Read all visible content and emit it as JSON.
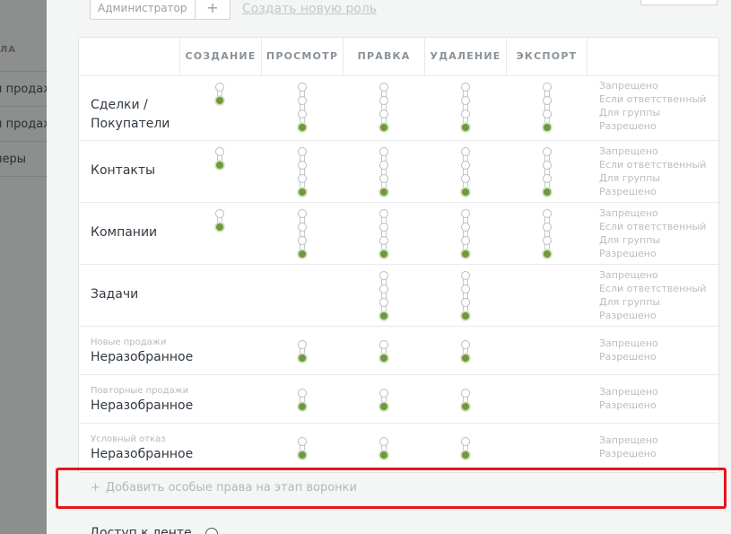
{
  "sidebar": {
    "header": "ЛА",
    "items": [
      {
        "label": "и продаж"
      },
      {
        "label": "и продаж"
      },
      {
        "label": "неры"
      }
    ]
  },
  "roles": {
    "selected": "Администратор",
    "add_symbol": "+",
    "create_link": "Создать новую роль"
  },
  "columns": [
    "СОЗДАНИЕ",
    "ПРОСМОТР",
    "ПРАВКА",
    "УДАЛЕНИЕ",
    "ЭКСПОРТ"
  ],
  "legend_full": [
    "Запрещено",
    "Если ответственный",
    "Для группы",
    "Разрешено"
  ],
  "legend_short": [
    "Запрещено",
    "Разрешено"
  ],
  "rows": [
    {
      "label_line1": "Сделки /",
      "label_line2": "Покупатели",
      "sublabel": ""
    },
    {
      "label_line1": "Контакты",
      "label_line2": "",
      "sublabel": ""
    },
    {
      "label_line1": "Компании",
      "label_line2": "",
      "sublabel": ""
    },
    {
      "label_line1": "Задачи",
      "label_line2": "",
      "sublabel": ""
    },
    {
      "label_line1": "Неразобранное",
      "label_line2": "",
      "sublabel": "Новые продажи"
    },
    {
      "label_line1": "Неразобранное",
      "label_line2": "",
      "sublabel": "Повторные продажи"
    },
    {
      "label_line1": "Неразобранное",
      "label_line2": "",
      "sublabel": "Условный отказ"
    }
  ],
  "permissions": [
    {
      "levels": [
        2,
        4,
        4,
        4,
        4
      ],
      "selected": [
        2,
        4,
        4,
        4,
        4
      ]
    },
    {
      "levels": [
        2,
        4,
        4,
        4,
        4
      ],
      "selected": [
        2,
        4,
        4,
        4,
        4
      ]
    },
    {
      "levels": [
        2,
        4,
        4,
        4,
        4
      ],
      "selected": [
        2,
        4,
        4,
        4,
        4
      ]
    },
    {
      "levels": [
        0,
        0,
        4,
        4,
        0
      ],
      "selected": [
        0,
        0,
        4,
        4,
        0
      ]
    },
    {
      "levels": [
        0,
        2,
        2,
        2,
        0
      ],
      "selected": [
        0,
        2,
        2,
        2,
        0
      ]
    },
    {
      "levels": [
        0,
        2,
        2,
        2,
        0
      ],
      "selected": [
        0,
        2,
        2,
        2,
        0
      ]
    },
    {
      "levels": [
        0,
        2,
        2,
        2,
        0
      ],
      "selected": [
        0,
        2,
        2,
        2,
        0
      ]
    }
  ],
  "add_special": {
    "plus": "+",
    "label": "Добавить особые права на этап воронки"
  },
  "bottom": {
    "label": "Доступ к ленте"
  },
  "colors": {
    "accent_green": "#6f9a3c",
    "highlight_red": "#e8141b"
  }
}
